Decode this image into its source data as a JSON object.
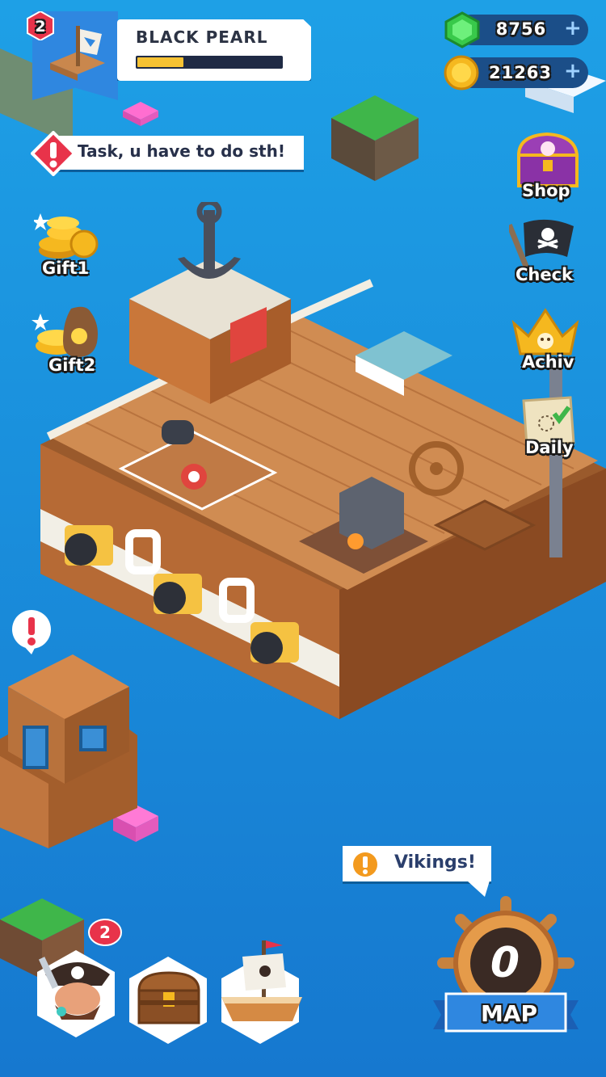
{
  "profile": {
    "ship_name": "BLACK PEARL",
    "level": "2",
    "exp_progress": 0.32
  },
  "currency": {
    "gems": "8756",
    "coins": "21263",
    "plus": "+"
  },
  "task": {
    "text": "Task, u have to do sth!"
  },
  "side_menu_right": [
    {
      "label": "Shop",
      "icon": "treasure-chest-icon"
    },
    {
      "label": "Check",
      "icon": "pirate-flag-icon"
    },
    {
      "label": "Achiv",
      "icon": "crown-icon"
    },
    {
      "label": "Daily",
      "icon": "scroll-icon"
    }
  ],
  "side_menu_left": [
    {
      "label": "Gift1",
      "icon": "gold-coins-icon"
    },
    {
      "label": "Gift2",
      "icon": "money-bag-icon"
    }
  ],
  "vikings_alert": {
    "text": "Vikings!"
  },
  "map_button": {
    "label": "MAP",
    "count": "0"
  },
  "bottom_bar": {
    "crew_badge": "2"
  },
  "colors": {
    "sea": "#1a8fdc",
    "wood": "#c8844a",
    "accent_red": "#e8334a",
    "gold": "#f6c233",
    "panel_blue": "#2f87e0"
  }
}
